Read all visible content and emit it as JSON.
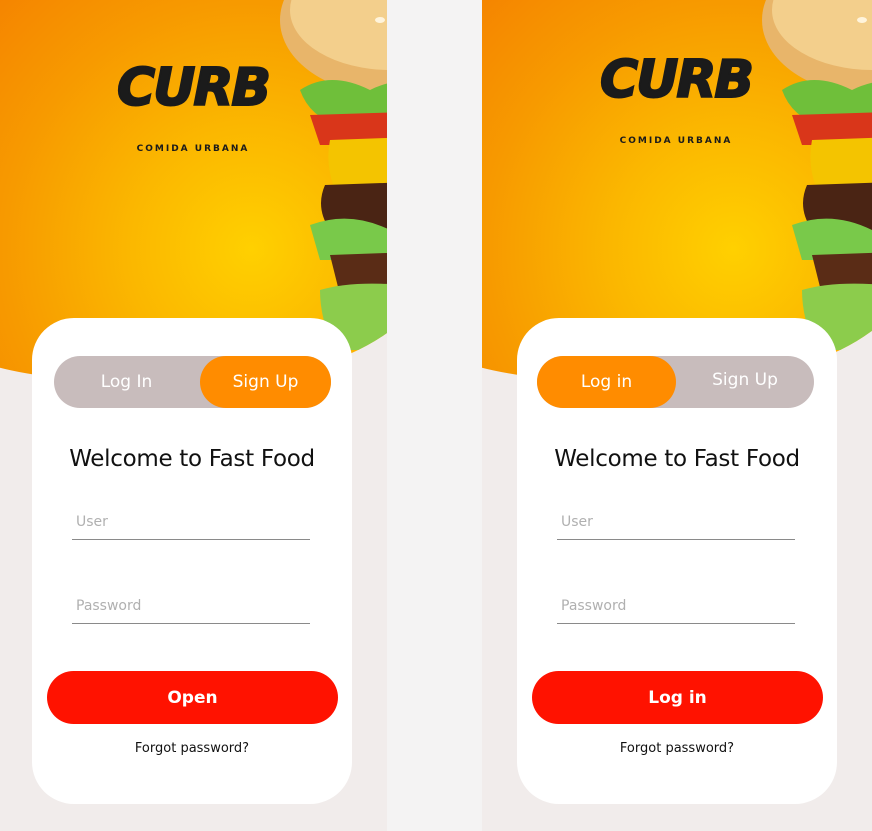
{
  "brand": {
    "name": "CURB",
    "tagline": "COMIDA URBANA"
  },
  "colors": {
    "accent_orange": "#ff8c00",
    "primary_red": "#ff1200",
    "toggle_inactive": "#c8bcbc",
    "background": "#f1eceb"
  },
  "screens": [
    {
      "toggle": {
        "login_label": "Log In",
        "signup_label": "Sign Up",
        "active": "signup"
      },
      "welcome": "Welcome to Fast Food",
      "user_placeholder": "User",
      "password_placeholder": "Password",
      "primary_button": "Open",
      "forgot_link": "Forgot password?"
    },
    {
      "toggle": {
        "login_label": "Log in",
        "signup_label": "Sign Up",
        "active": "login"
      },
      "welcome": "Welcome to Fast Food",
      "user_placeholder": "User",
      "password_placeholder": "Password",
      "primary_button": "Log in",
      "forgot_link": "Forgot password?"
    }
  ],
  "icons": {
    "hero_image": "burger-image"
  }
}
